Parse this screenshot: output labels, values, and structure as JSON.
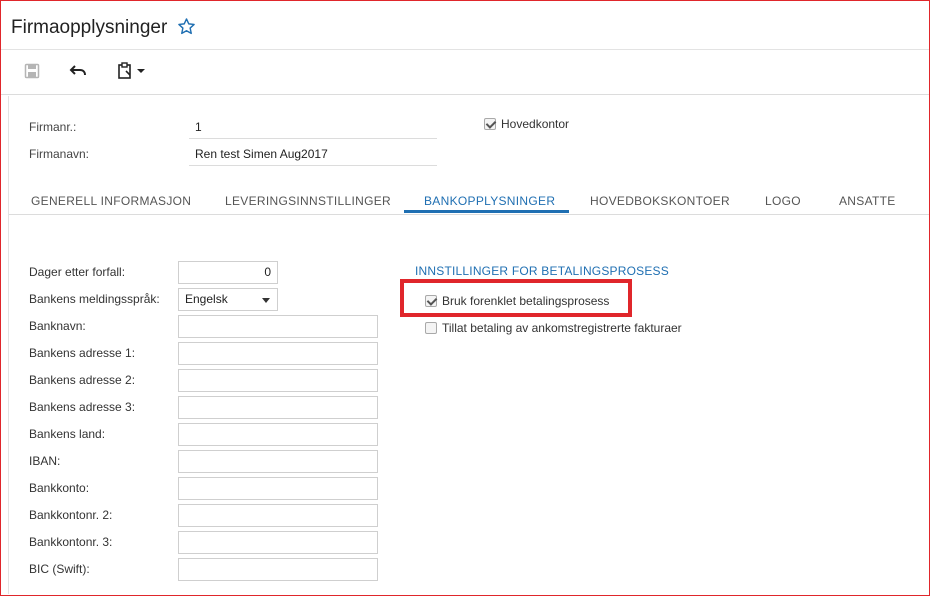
{
  "window": {
    "title": "Firmaopplysninger",
    "star_icon": "star-outline-icon"
  },
  "toolbar": {
    "save_icon": "save-icon",
    "undo_icon": "undo-icon",
    "clipboard_icon": "clipboard-icon",
    "dropdown_icon": "chevron-down-icon"
  },
  "header": {
    "company_no_label": "Firmanr.:",
    "company_no_value": "1",
    "company_name_label": "Firmanavn:",
    "company_name_value": "Ren test Simen Aug2017",
    "head_office_label": "Hovedkontor",
    "head_office_checked": true
  },
  "tabs": [
    {
      "label": "GENERELL INFORMASJON",
      "active": false
    },
    {
      "label": "LEVERINGSINNSTILLINGER",
      "active": false
    },
    {
      "label": "BANKOPPLYSNINGER",
      "active": true
    },
    {
      "label": "HOVEDBOKSKONTOER",
      "active": false
    },
    {
      "label": "LOGO",
      "active": false
    },
    {
      "label": "ANSATTE",
      "active": false
    }
  ],
  "bank": {
    "fields": [
      {
        "label": "Dager etter forfall:",
        "value": "0"
      },
      {
        "label": "Bankens meldingsspråk:",
        "value": "Engelsk"
      },
      {
        "label": "Banknavn:",
        "value": ""
      },
      {
        "label": "Bankens adresse 1:",
        "value": ""
      },
      {
        "label": "Bankens adresse 2:",
        "value": ""
      },
      {
        "label": "Bankens adresse 3:",
        "value": ""
      },
      {
        "label": "Bankens land:",
        "value": ""
      },
      {
        "label": "IBAN:",
        "value": ""
      },
      {
        "label": "Bankkonto:",
        "value": ""
      },
      {
        "label": "Bankkontonr. 2:",
        "value": ""
      },
      {
        "label": "Bankkontonr. 3:",
        "value": ""
      },
      {
        "label": "BIC (Swift):",
        "value": ""
      }
    ]
  },
  "payment_settings": {
    "title": "INNSTILLINGER FOR BETALINGSPROSESS",
    "options": [
      {
        "label": "Bruk forenklet betalingsprosess",
        "checked": true
      },
      {
        "label": "Tillat betaling av ankomstregistrerte fakturaer",
        "checked": false
      }
    ]
  },
  "colors": {
    "accent": "#1f6fb2",
    "highlight": "#e0262b"
  }
}
